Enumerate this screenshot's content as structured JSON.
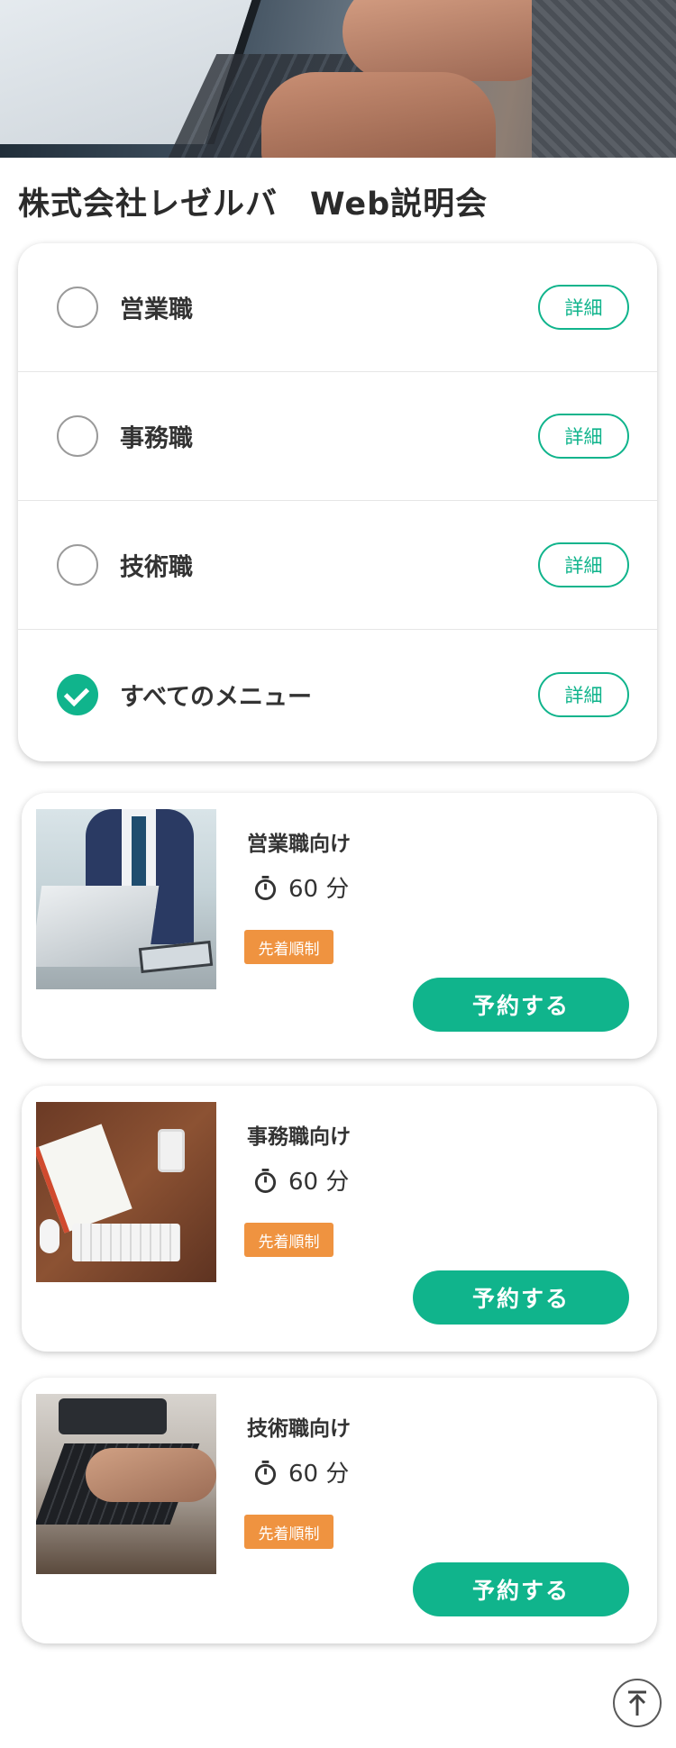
{
  "header": {
    "title": "株式会社レゼルバ　Web説明会"
  },
  "menu": {
    "items": [
      {
        "label": "営業職",
        "detail_label": "詳細",
        "checked": false
      },
      {
        "label": "事務職",
        "detail_label": "詳細",
        "checked": false
      },
      {
        "label": "技術職",
        "detail_label": "詳細",
        "checked": false
      },
      {
        "label": "すべてのメニュー",
        "detail_label": "詳細",
        "checked": true
      }
    ]
  },
  "events": [
    {
      "title": "営業職向け",
      "duration": "60 分",
      "badge": "先着順制",
      "reserve_label": "予約する",
      "image": "sales-meeting-photo"
    },
    {
      "title": "事務職向け",
      "duration": "60 分",
      "badge": "先着順制",
      "reserve_label": "予約する",
      "image": "office-desk-photo"
    },
    {
      "title": "技術職向け",
      "duration": "60 分",
      "badge": "先着順制",
      "reserve_label": "予約する",
      "image": "keyboard-typing-photo"
    }
  ],
  "icons": {
    "timer": "stopwatch-icon",
    "back_to_top": "arrow-up-icon",
    "check": "check-icon"
  },
  "colors": {
    "accent": "#10b48c",
    "badge": "#ef9340",
    "text": "#333333"
  }
}
